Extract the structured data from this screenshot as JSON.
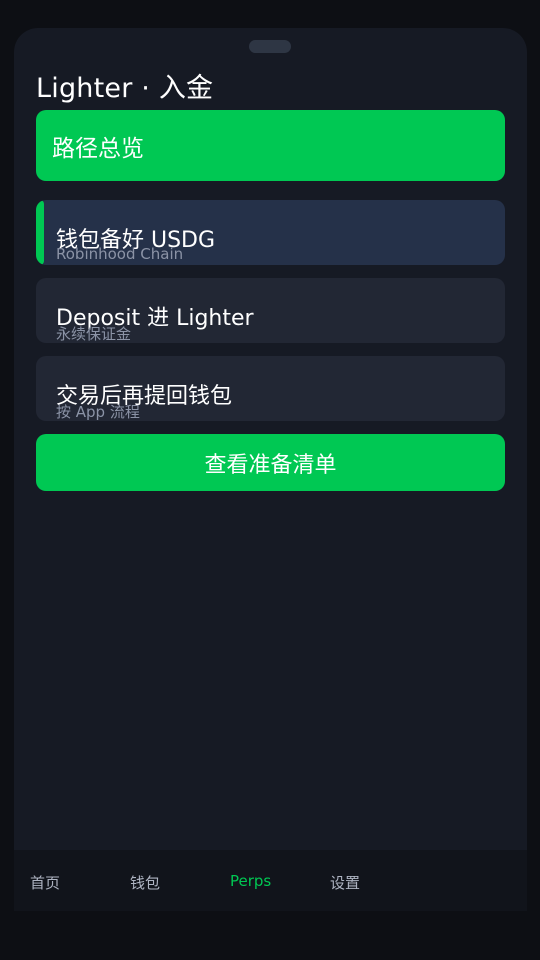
{
  "sheet": {
    "title": "Lighter · 入金"
  },
  "overview": {
    "label": "路径总览"
  },
  "steps": [
    {
      "title": "钱包备好 USDG",
      "subtitle": "Robinhood Chain",
      "active": true
    },
    {
      "title": "Deposit 进 Lighter",
      "subtitle": "永续保证金",
      "active": false
    },
    {
      "title": "交易后再提回钱包",
      "subtitle": "按 App 流程",
      "active": false
    }
  ],
  "cta": {
    "label": "查看准备清单"
  },
  "tabs": [
    {
      "label": "首页",
      "active": false
    },
    {
      "label": "钱包",
      "active": false
    },
    {
      "label": "Perps",
      "active": true
    },
    {
      "label": "设置",
      "active": false
    }
  ],
  "colors": {
    "accent": "#00c853",
    "background": "#0d0f14",
    "sheet": "#161a24",
    "card": "#222734",
    "card_active": "#253149"
  }
}
